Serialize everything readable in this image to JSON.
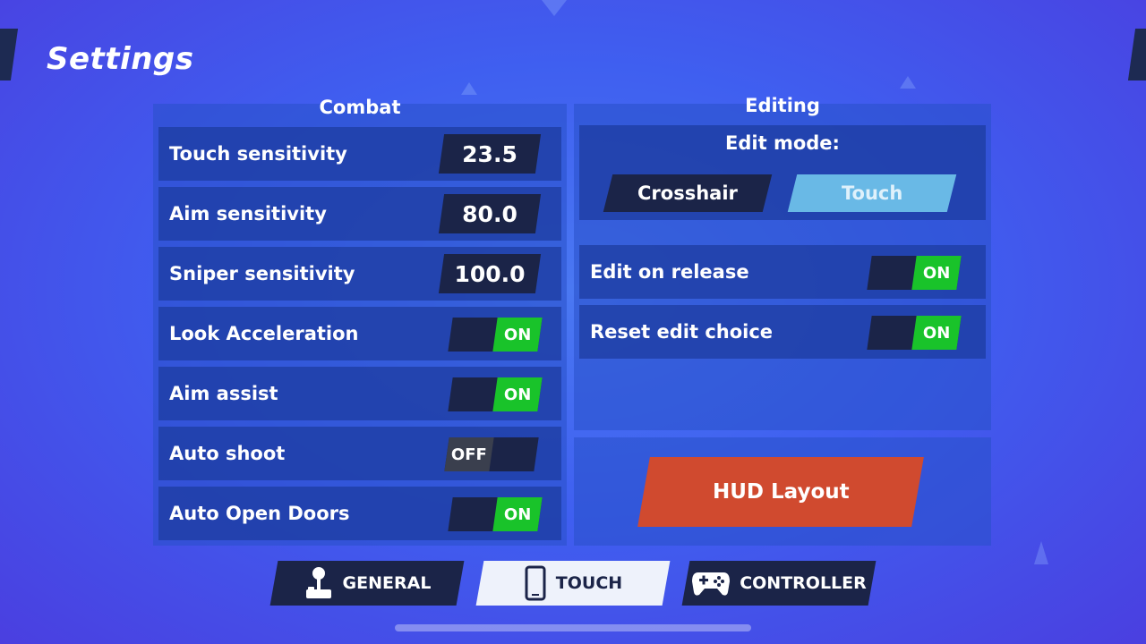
{
  "title": "Settings",
  "combat": {
    "heading": "Combat",
    "rows": [
      {
        "label": "Touch sensitivity",
        "value": "23.5"
      },
      {
        "label": "Aim sensitivity",
        "value": "80.0"
      },
      {
        "label": "Sniper sensitivity",
        "value": "100.0"
      },
      {
        "label": "Look Acceleration",
        "state": "ON"
      },
      {
        "label": "Aim assist",
        "state": "ON"
      },
      {
        "label": "Auto shoot",
        "state": "OFF"
      },
      {
        "label": "Auto Open Doors",
        "state": "ON"
      }
    ]
  },
  "editing": {
    "heading": "Editing",
    "edit_mode_label": "Edit mode:",
    "modes": [
      "Crosshair",
      "Touch"
    ],
    "selected_mode": "Touch",
    "rows": [
      {
        "label": "Edit on release",
        "state": "ON"
      },
      {
        "label": "Reset edit choice",
        "state": "ON"
      }
    ]
  },
  "hud_button": "HUD Layout",
  "tabs": [
    {
      "label": "GENERAL",
      "icon": "joystick-icon"
    },
    {
      "label": "TOUCH",
      "icon": "phone-icon"
    },
    {
      "label": "CONTROLLER",
      "icon": "gamepad-icon"
    }
  ],
  "active_tab": "TOUCH",
  "colors": {
    "on": "#19c32a",
    "off": "#3a3f4e",
    "hud": "#d04a2f",
    "accent": "#69b9e6"
  }
}
